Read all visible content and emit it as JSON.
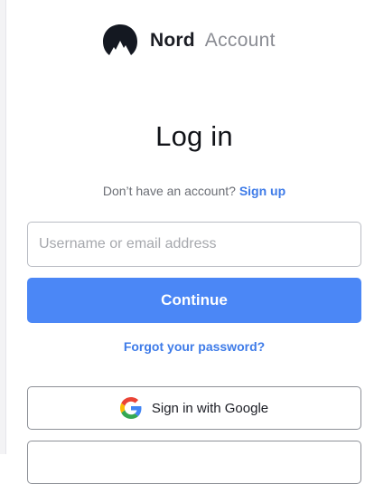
{
  "brand": {
    "name": "Nord",
    "product": "Account",
    "logo_icon": "nord-mountain-icon"
  },
  "page": {
    "title": "Log in"
  },
  "signup": {
    "prompt": "Don’t have an account?",
    "link_label": "Sign up"
  },
  "login_form": {
    "username_value": "",
    "username_placeholder": "Username or email address",
    "continue_label": "Continue",
    "forgot_label": "Forgot your password?"
  },
  "social_login": {
    "google_label": "Sign in with Google",
    "google_icon": "google-g-icon"
  },
  "colors": {
    "primary_button": "#4b87f6",
    "link": "#3e7be8",
    "text_dark": "#111318",
    "text_muted": "#6b6e75"
  }
}
